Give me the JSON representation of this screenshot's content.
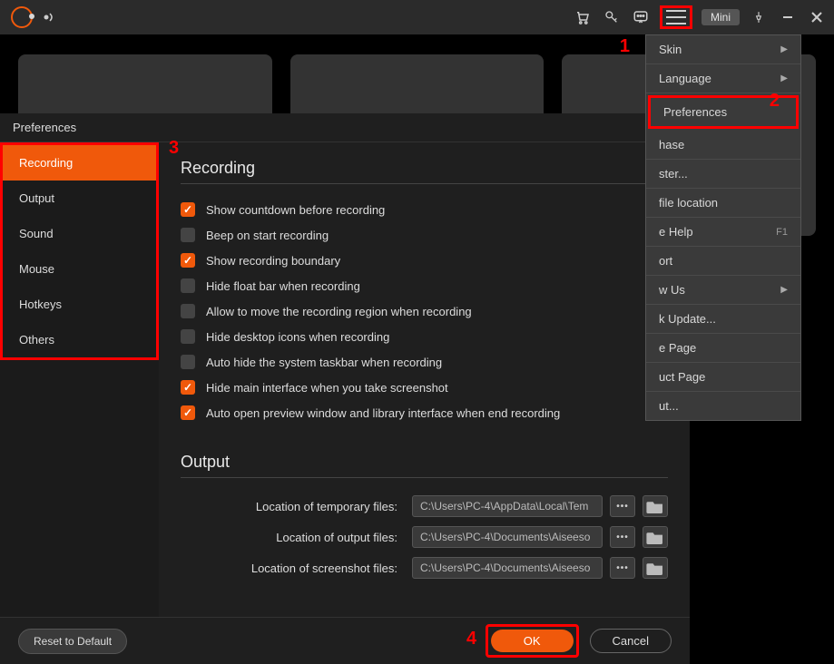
{
  "titlebar": {
    "mini": "Mini"
  },
  "dropdown": {
    "items": [
      {
        "label": "Skin",
        "arrow": true
      },
      {
        "label": "Language",
        "arrow": true
      },
      {
        "label": "Preferences",
        "highlight": true
      },
      {
        "label": "Purchase",
        "partial": "hase"
      },
      {
        "label": "Register...",
        "partial": "ster..."
      },
      {
        "label": "Open file location",
        "partial": "file location"
      },
      {
        "label": "Online Help",
        "partial": "e Help",
        "shortcut": "F1"
      },
      {
        "label": "Support",
        "partial": "ort"
      },
      {
        "label": "Follow Us",
        "partial": "w Us",
        "arrow": true
      },
      {
        "label": "Check Update...",
        "partial": "k Update..."
      },
      {
        "label": "Home Page",
        "partial": "e Page"
      },
      {
        "label": "Product Page",
        "partial": "uct Page"
      },
      {
        "label": "About...",
        "partial": "ut..."
      }
    ]
  },
  "annotations": {
    "n1": "1",
    "n2": "2",
    "n3": "3",
    "n4": "4"
  },
  "preferences": {
    "title": "Preferences",
    "sidebar": [
      "Recording",
      "Output",
      "Sound",
      "Mouse",
      "Hotkeys",
      "Others"
    ],
    "recording": {
      "title": "Recording",
      "options": [
        {
          "label": "Show countdown before recording",
          "checked": true
        },
        {
          "label": "Beep on start recording",
          "checked": false
        },
        {
          "label": "Show recording boundary",
          "checked": true
        },
        {
          "label": "Hide float bar when recording",
          "checked": false
        },
        {
          "label": "Allow to move the recording region when recording",
          "checked": false
        },
        {
          "label": "Hide desktop icons when recording",
          "checked": false
        },
        {
          "label": "Auto hide the system taskbar when recording",
          "checked": false
        },
        {
          "label": "Hide main interface when you take screenshot",
          "checked": true
        },
        {
          "label": "Auto open preview window and library interface when end recording",
          "checked": true
        }
      ]
    },
    "output": {
      "title": "Output",
      "rows": [
        {
          "label": "Location of temporary files:",
          "value": "C:\\Users\\PC-4\\AppData\\Local\\Tem"
        },
        {
          "label": "Location of output files:",
          "value": "C:\\Users\\PC-4\\Documents\\Aiseeso"
        },
        {
          "label": "Location of screenshot files:",
          "value": "C:\\Users\\PC-4\\Documents\\Aiseeso"
        }
      ]
    },
    "footer": {
      "reset": "Reset to Default",
      "ok": "OK",
      "cancel": "Cancel"
    }
  }
}
